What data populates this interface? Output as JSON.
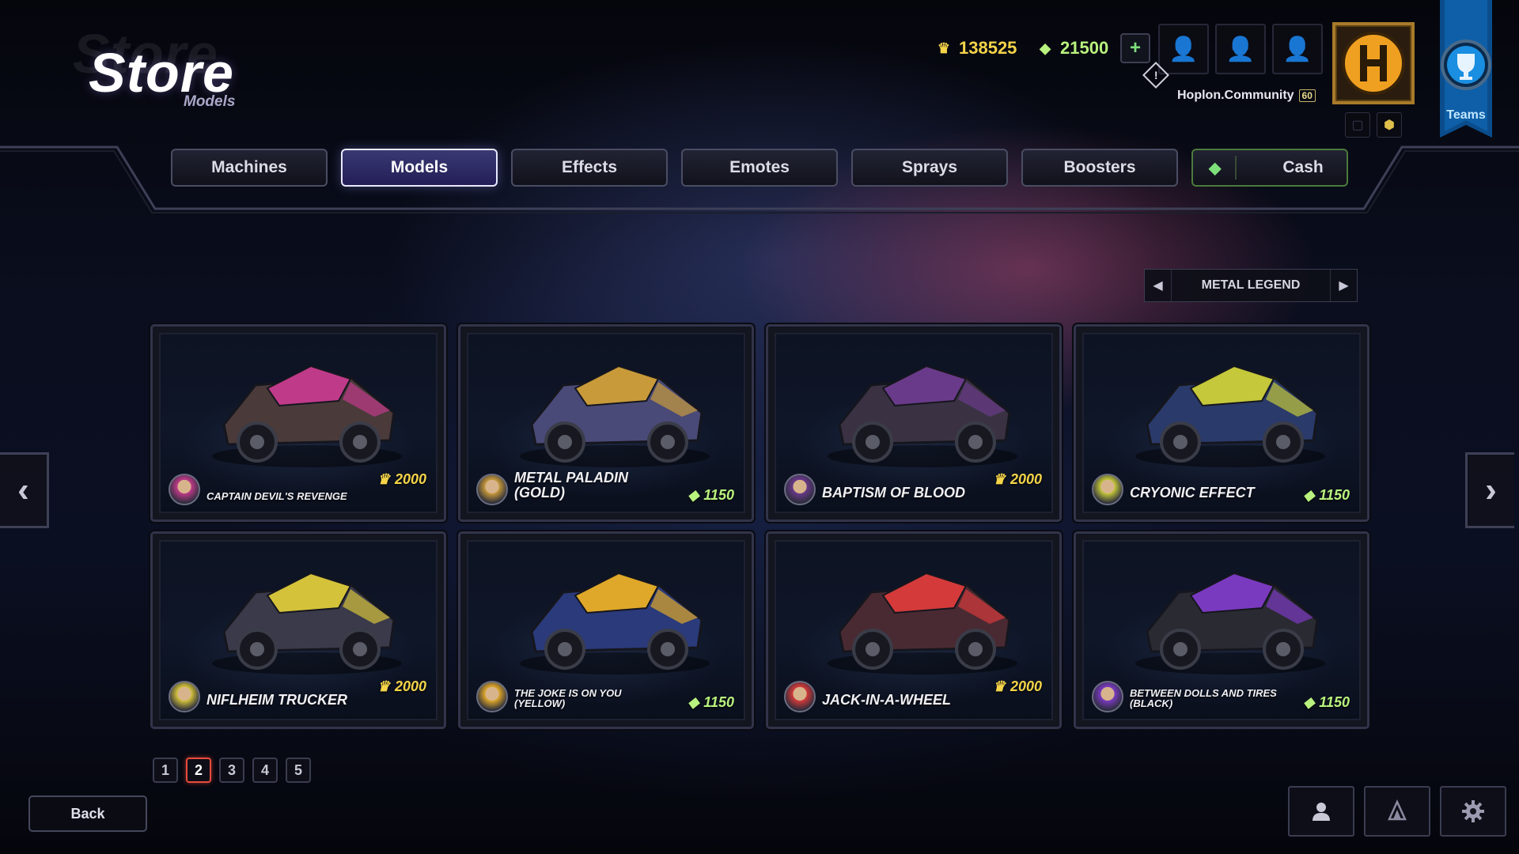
{
  "header": {
    "title": "Store",
    "subtitle": "Models"
  },
  "currency": {
    "gold": "138525",
    "cash": "21500",
    "add_label": "+"
  },
  "profile": {
    "username": "Hoplon.Community",
    "level": "60",
    "teams_label": "Teams"
  },
  "tabs": [
    {
      "label": "Machines"
    },
    {
      "label": "Models",
      "active": true
    },
    {
      "label": "Effects"
    },
    {
      "label": "Emotes"
    },
    {
      "label": "Sprays"
    },
    {
      "label": "Boosters"
    },
    {
      "label": "Cash"
    }
  ],
  "selector": {
    "label": "METAL LEGEND"
  },
  "cards": [
    {
      "name": "CAPTAIN DEVIL'S REVENGE",
      "price": "2000",
      "currency": "gold",
      "accent": "#c03a8a",
      "body": "#4a3a3a"
    },
    {
      "name": "METAL PALADIN (GOLD)",
      "price": "1150",
      "currency": "cash",
      "accent": "#c89a3a",
      "body": "#4a4a78"
    },
    {
      "name": "BAPTISM OF BLOOD",
      "price": "2000",
      "currency": "gold",
      "accent": "#6a3a8a",
      "body": "#3a3242"
    },
    {
      "name": "CRYONIC EFFECT",
      "price": "1150",
      "currency": "cash",
      "accent": "#c4c83a",
      "body": "#2a3a6a"
    },
    {
      "name": "NIFLHEIM TRUCKER",
      "price": "2000",
      "currency": "gold",
      "accent": "#d4c23a",
      "body": "#3a3a4a"
    },
    {
      "name": "THE JOKE IS ON YOU (YELLOW)",
      "price": "1150",
      "currency": "cash",
      "accent": "#e0a82a",
      "body": "#2a3a7a"
    },
    {
      "name": "JACK-IN-A-WHEEL",
      "price": "2000",
      "currency": "gold",
      "accent": "#d43a3a",
      "body": "#4a2a32"
    },
    {
      "name": "BETWEEN DOLLS AND TIRES (BLACK)",
      "price": "1150",
      "currency": "cash",
      "accent": "#7a3ac0",
      "body": "#2a2a32"
    }
  ],
  "pagination": {
    "pages": [
      "1",
      "2",
      "3",
      "4",
      "5"
    ],
    "current": "2"
  },
  "footer": {
    "back_label": "Back"
  },
  "icons": {
    "gold": "crown-coin-icon",
    "cash": "gem-icon",
    "settings": "gear-icon",
    "profile": "person-icon",
    "spray": "spray-icon"
  },
  "colors": {
    "gold": "#f4d44a",
    "cash": "#b9f27e",
    "active_page": "#e94b3c",
    "active_tab": "#e8e8ff"
  }
}
